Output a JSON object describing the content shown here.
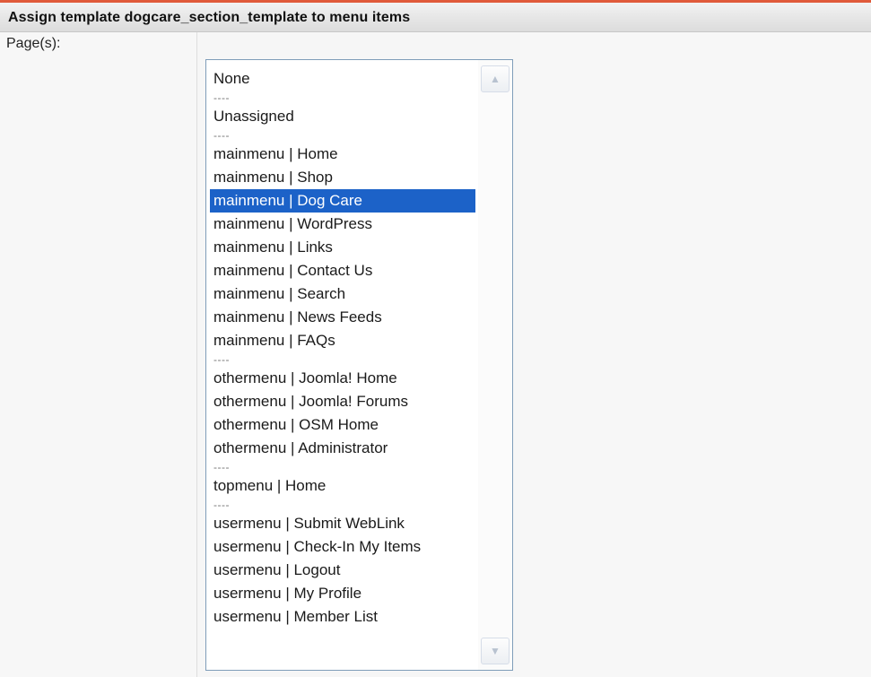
{
  "header": {
    "title": "Assign template dogcare_section_template to menu items"
  },
  "form": {
    "pages_label": "Page(s):"
  },
  "pages_list": {
    "options": [
      {
        "label": "None",
        "type": "item"
      },
      {
        "label": "----",
        "type": "sep"
      },
      {
        "label": "Unassigned",
        "type": "item"
      },
      {
        "label": "----",
        "type": "sep"
      },
      {
        "label": "mainmenu | Home",
        "type": "item"
      },
      {
        "label": "mainmenu | Shop",
        "type": "item"
      },
      {
        "label": "mainmenu | Dog Care",
        "type": "item",
        "selected": true
      },
      {
        "label": "mainmenu | WordPress",
        "type": "item"
      },
      {
        "label": "mainmenu | Links",
        "type": "item"
      },
      {
        "label": "mainmenu | Contact Us",
        "type": "item"
      },
      {
        "label": "mainmenu | Search",
        "type": "item"
      },
      {
        "label": "mainmenu | News Feeds",
        "type": "item"
      },
      {
        "label": "mainmenu | FAQs",
        "type": "item"
      },
      {
        "label": "----",
        "type": "sep"
      },
      {
        "label": "othermenu | Joomla! Home",
        "type": "item"
      },
      {
        "label": "othermenu | Joomla! Forums",
        "type": "item"
      },
      {
        "label": "othermenu | OSM Home",
        "type": "item"
      },
      {
        "label": "othermenu | Administrator",
        "type": "item"
      },
      {
        "label": "----",
        "type": "sep"
      },
      {
        "label": "topmenu | Home",
        "type": "item"
      },
      {
        "label": "----",
        "type": "sep"
      },
      {
        "label": "usermenu | Submit WebLink",
        "type": "item"
      },
      {
        "label": "usermenu | Check-In My Items",
        "type": "item"
      },
      {
        "label": "usermenu | Logout",
        "type": "item"
      },
      {
        "label": "usermenu | My Profile",
        "type": "item"
      },
      {
        "label": "usermenu | Member List",
        "type": "item"
      }
    ],
    "scroll_up_icon": "chevron-up-icon",
    "scroll_down_icon": "chevron-down-icon"
  },
  "colors": {
    "accent_rule": "#e05a3a",
    "selection": "#1c62c8"
  }
}
